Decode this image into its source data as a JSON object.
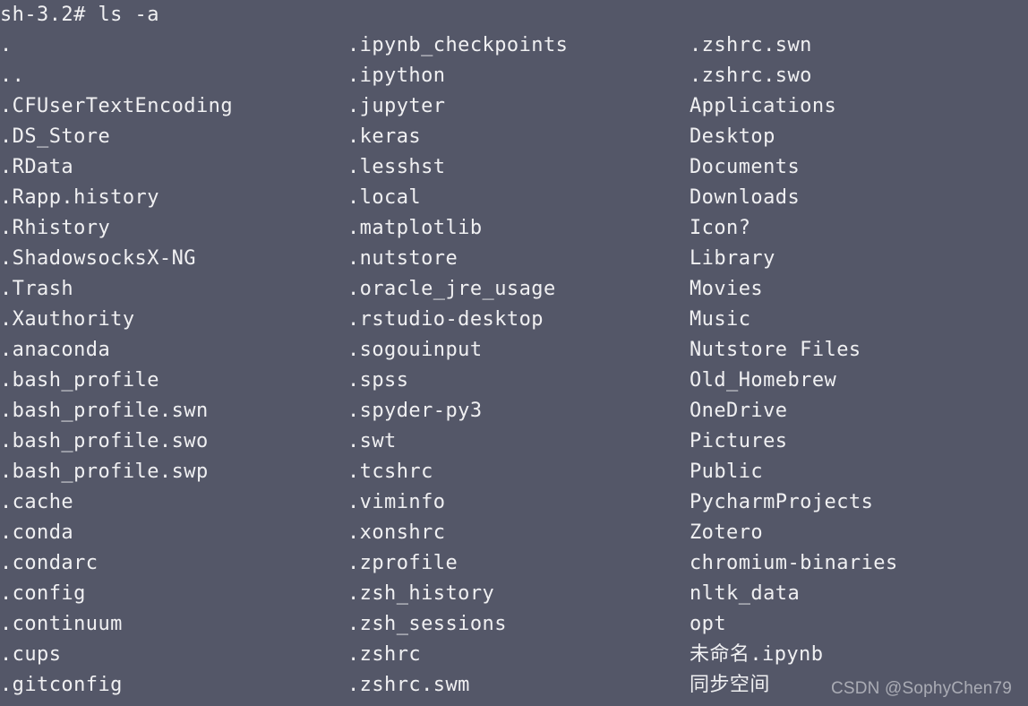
{
  "terminal": {
    "background_color": "#545768",
    "text_color": "#f0f0f2",
    "prompt": "sh-3.2# ls -a",
    "columns": [
      {
        "entries": [
          ".",
          "..",
          ".CFUserTextEncoding",
          ".DS_Store",
          ".RData",
          ".Rapp.history",
          ".Rhistory",
          ".ShadowsocksX-NG",
          ".Trash",
          ".Xauthority",
          ".anaconda",
          ".bash_profile",
          ".bash_profile.swn",
          ".bash_profile.swo",
          ".bash_profile.swp",
          ".cache",
          ".conda",
          ".condarc",
          ".config",
          ".continuum",
          ".cups",
          ".gitconfig"
        ]
      },
      {
        "entries": [
          ".ipynb_checkpoints",
          ".ipython",
          ".jupyter",
          ".keras",
          ".lesshst",
          ".local",
          ".matplotlib",
          ".nutstore",
          ".oracle_jre_usage",
          ".rstudio-desktop",
          ".sogouinput",
          ".spss",
          ".spyder-py3",
          ".swt",
          ".tcshrc",
          ".viminfo",
          ".xonshrc",
          ".zprofile",
          ".zsh_history",
          ".zsh_sessions",
          ".zshrc",
          ".zshrc.swm"
        ]
      },
      {
        "entries": [
          ".zshrc.swn",
          ".zshrc.swo",
          "Applications",
          "Desktop",
          "Documents",
          "Downloads",
          "Icon?",
          "Library",
          "Movies",
          "Music",
          "Nutstore Files",
          "Old_Homebrew",
          "OneDrive",
          "Pictures",
          "Public",
          "PycharmProjects",
          "Zotero",
          "chromium-binaries",
          "nltk_data",
          "opt",
          "未命名.ipynb",
          "同步空间"
        ]
      }
    ]
  },
  "watermark": {
    "text": "CSDN @SophyChen79"
  }
}
